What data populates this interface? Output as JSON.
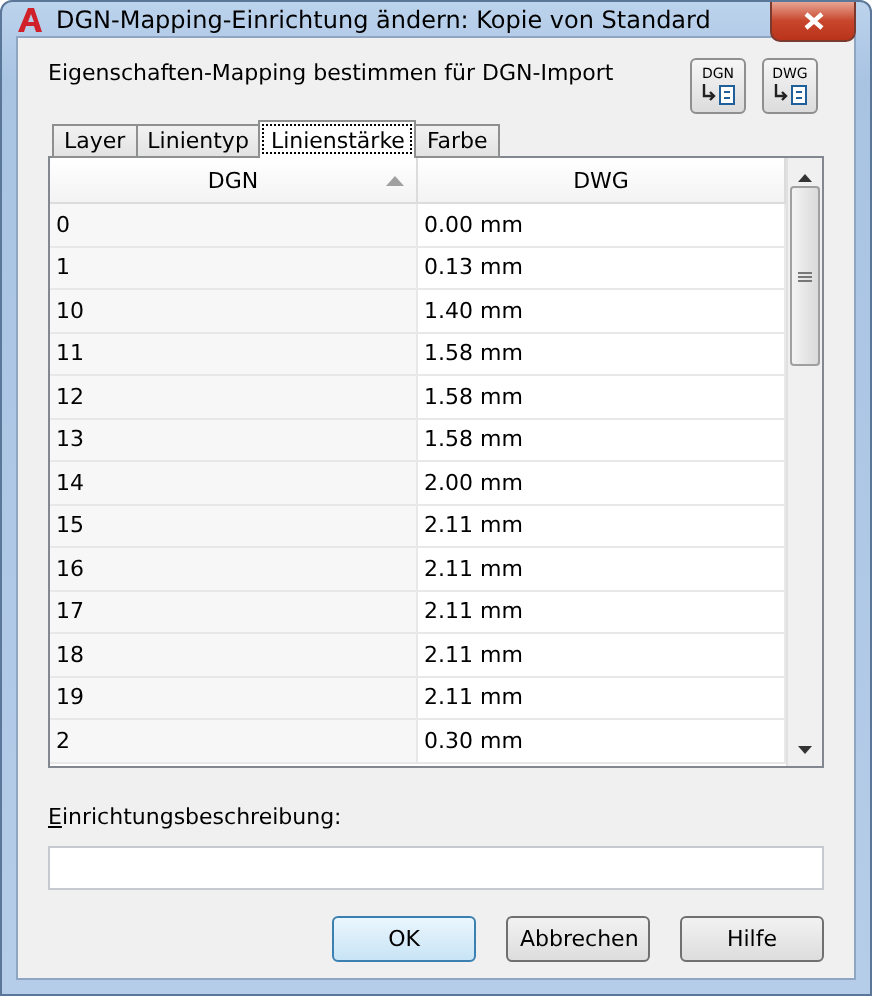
{
  "window": {
    "title": "DGN-Mapping-Einrichtung ändern: Kopie von Standard"
  },
  "heading": "Eigenschaften-Mapping bestimmen für DGN-Import",
  "icon_buttons": [
    {
      "label": "DGN"
    },
    {
      "label": "DWG"
    }
  ],
  "tabs": [
    {
      "label": "Layer",
      "selected": false
    },
    {
      "label": "Linientyp",
      "selected": false
    },
    {
      "label": "Linienstärke",
      "selected": true
    },
    {
      "label": "Farbe",
      "selected": false
    }
  ],
  "table": {
    "columns": [
      {
        "label": "DGN",
        "sorted": true
      },
      {
        "label": "DWG",
        "sorted": false
      }
    ],
    "rows": [
      {
        "dgn": "0",
        "dwg": "0.00 mm"
      },
      {
        "dgn": "1",
        "dwg": "0.13 mm"
      },
      {
        "dgn": "10",
        "dwg": "1.40 mm"
      },
      {
        "dgn": "11",
        "dwg": "1.58 mm"
      },
      {
        "dgn": "12",
        "dwg": "1.58 mm"
      },
      {
        "dgn": "13",
        "dwg": "1.58 mm"
      },
      {
        "dgn": "14",
        "dwg": "2.00 mm"
      },
      {
        "dgn": "15",
        "dwg": "2.11 mm"
      },
      {
        "dgn": "16",
        "dwg": "2.11 mm"
      },
      {
        "dgn": "17",
        "dwg": "2.11 mm"
      },
      {
        "dgn": "18",
        "dwg": "2.11 mm"
      },
      {
        "dgn": "19",
        "dwg": "2.11 mm"
      },
      {
        "dgn": "2",
        "dwg": "0.30 mm"
      }
    ]
  },
  "description": {
    "label": "Einrichtungsbeschreibung:"
  },
  "buttons": [
    {
      "label": "OK",
      "default": true
    },
    {
      "label": "Abbrechen",
      "default": false
    },
    {
      "label": "Hilfe",
      "default": false
    }
  ]
}
